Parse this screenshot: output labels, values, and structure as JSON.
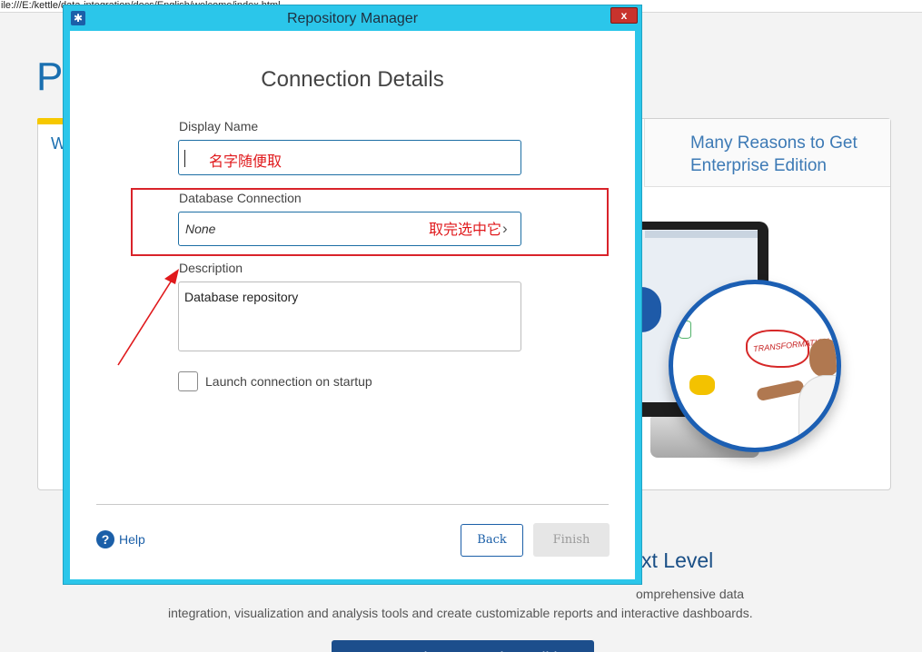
{
  "browser": {
    "url": "ile:///E:/kettle/data-integration/docs/English/welcome/index.html"
  },
  "background": {
    "logo_text": "Pe",
    "panel_letter": "W",
    "reasons_text": "Many Reasons to Get Enterprise Edition",
    "illustration_text": "TRANSFORMATION",
    "next_level_text": "xt Level",
    "desc_line1": "omprehensive data",
    "desc_line2": "integration, visualization and analysis tools and create customizable reports and interactive dashboards.",
    "cta_label": "Get Pentaho Enterprise Edition"
  },
  "dialog": {
    "title": "Repository Manager",
    "close_label": "x",
    "heading": "Connection Details",
    "display_name": {
      "label": "Display Name",
      "value": "",
      "annotation": "名字随便取"
    },
    "database_connection": {
      "label": "Database Connection",
      "value": "None",
      "annotation": "取完选中它"
    },
    "description": {
      "label": "Description",
      "value": "Database repository"
    },
    "launch_checkbox": {
      "label": "Launch connection on startup",
      "checked": false
    },
    "help_label": "Help",
    "back_label": "Back",
    "finish_label": "Finish"
  },
  "colors": {
    "dialog_frame": "#2bc6ea",
    "accent_blue": "#1b5fa8",
    "annotation_red": "#e0191c"
  }
}
